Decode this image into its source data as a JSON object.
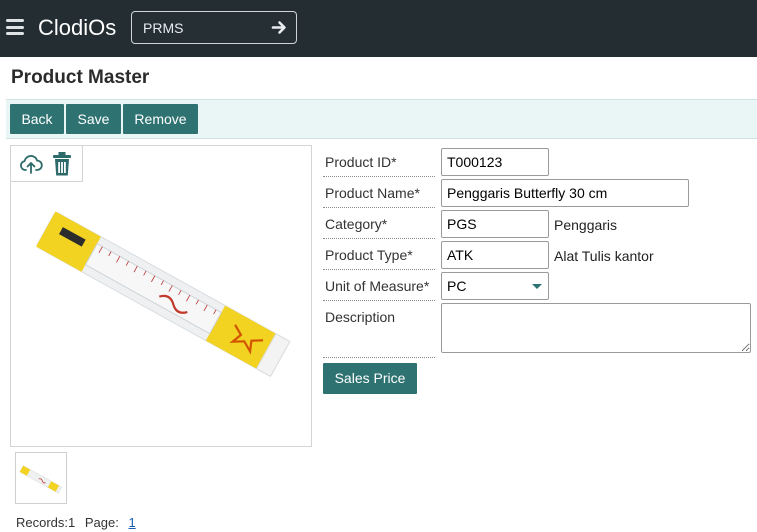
{
  "app": {
    "brand": "ClodiOs",
    "module": "PRMS"
  },
  "page": {
    "title": "Product Master"
  },
  "toolbar": {
    "back": "Back",
    "save": "Save",
    "remove": "Remove"
  },
  "form": {
    "product_id": {
      "label": "Product ID*",
      "value": "T000123"
    },
    "product_name": {
      "label": "Product Name*",
      "value": "Penggaris Butterfly 30 cm"
    },
    "category": {
      "label": "Category*",
      "value": "PGS",
      "description": "Penggaris"
    },
    "product_type": {
      "label": "Product Type*",
      "value": "ATK",
      "description": "Alat Tulis kantor"
    },
    "unit_of_measure": {
      "label": "Unit of Measure*",
      "value": "PC"
    },
    "description": {
      "label": "Description",
      "value": ""
    },
    "sales_price_button": "Sales Price"
  },
  "image": {
    "upload_icon": "upload-cloud-icon",
    "delete_icon": "trash-icon"
  },
  "footer": {
    "records_label": "Records:1",
    "page_label": "Page:",
    "page_number": "1"
  },
  "colors": {
    "topbar": "#232d32",
    "accent": "#2f7272",
    "toolbar_bg": "#eaf6f6"
  }
}
